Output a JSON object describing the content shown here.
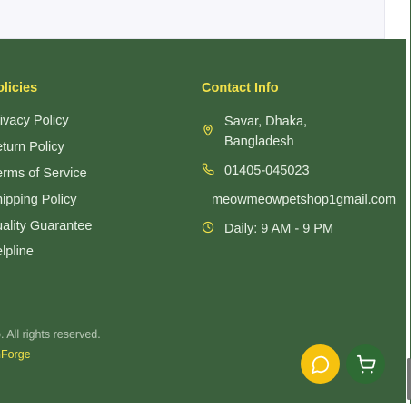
{
  "policies": {
    "heading": "olicies",
    "links": [
      "rivacy Policy",
      "eturn Policy",
      "erms of Service",
      "hipping Policy",
      "uality Guarantee",
      "elpline"
    ]
  },
  "contact": {
    "heading": "Contact Info",
    "address_line1": "Savar, Dhaka,",
    "address_line2": "Bangladesh",
    "phone": "01405-045023",
    "email": "meowmeowpetshop1gmail.com",
    "hours": "Daily: 9 AM - 9 PM"
  },
  "footer_bottom": {
    "copyright": "p. All rights reserved.",
    "credit": "nForge"
  },
  "icons": {
    "location": "map-pin-icon",
    "phone": "phone-icon",
    "hours": "clock-icon",
    "chat": "chat-bubble-icon",
    "cart": "shopping-cart-icon"
  },
  "colors": {
    "footer_bg": "#3b603d",
    "accent": "#f3e24b",
    "chat_button": "#f6c20f",
    "cart_button": "#2e6b34"
  }
}
